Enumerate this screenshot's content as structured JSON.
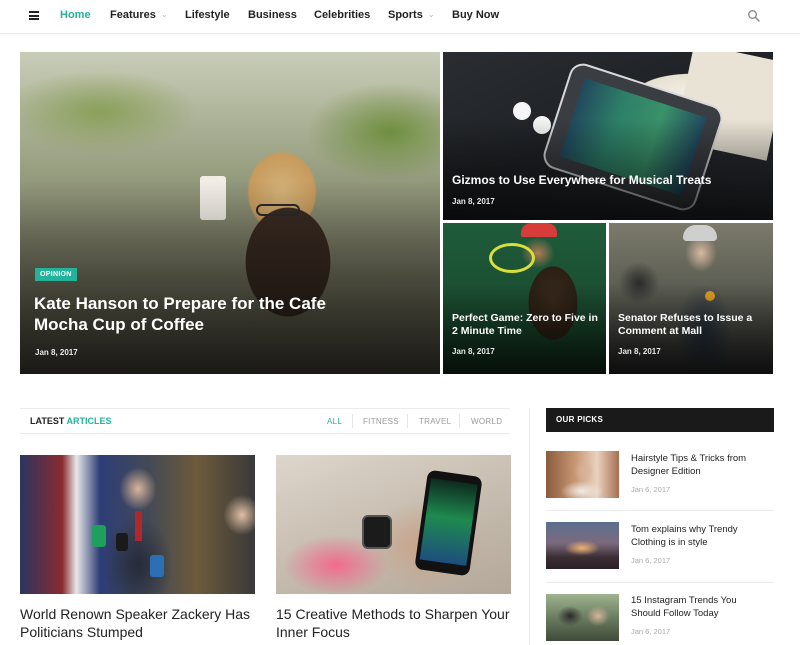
{
  "nav": {
    "items": [
      {
        "label": "Home",
        "active": true,
        "has_dropdown": false
      },
      {
        "label": "Features",
        "active": false,
        "has_dropdown": true
      },
      {
        "label": "Lifestyle",
        "active": false,
        "has_dropdown": false
      },
      {
        "label": "Business",
        "active": false,
        "has_dropdown": false
      },
      {
        "label": "Celebrities",
        "active": false,
        "has_dropdown": false
      },
      {
        "label": "Sports",
        "active": false,
        "has_dropdown": true
      },
      {
        "label": "Buy Now",
        "active": false,
        "has_dropdown": false
      }
    ],
    "dropdown_glyph": "⌄",
    "menu_icon": "hamburger-menu-icon",
    "search_icon": "search-icon"
  },
  "hero": {
    "main": {
      "badge": "OPINION",
      "title": "Kate Hanson to Prepare for the Cafe Mocha Cup of Coffee",
      "date": "Jan 8, 2017"
    },
    "top_right": {
      "title": "Gizmos to Use Everywhere for Musical Treats",
      "date": "Jan 8, 2017"
    },
    "bottom_left": {
      "title": "Perfect Game: Zero to Five in 2 Minute Time",
      "date": "Jan 8, 2017"
    },
    "bottom_right": {
      "title": "Senator Refuses to Issue a Comment at Mall",
      "date": "Jan 8, 2017"
    }
  },
  "latest": {
    "title_part1": "LATEST",
    "title_part2": "ARTICLES",
    "filters": [
      "ALL",
      "FITNESS",
      "TRAVEL",
      "WORLD"
    ],
    "active_filter": "ALL",
    "articles": [
      {
        "title": "World Renown Speaker Zackery Has Politicians Stumped"
      },
      {
        "title": "15 Creative Methods to Sharpen Your Inner Focus"
      }
    ]
  },
  "picks": {
    "heading": "OUR PICKS",
    "items": [
      {
        "title": "Hairstyle Tips & Tricks from Designer Edition",
        "date": "Jan 6, 2017"
      },
      {
        "title": "Tom explains why Trendy Clothing is in style",
        "date": "Jan 6, 2017"
      },
      {
        "title": "15 Instagram Trends You Should Follow Today",
        "date": "Jan 6, 2017"
      }
    ]
  },
  "colors": {
    "accent": "#23b29a",
    "dark": "#1a1a1a",
    "text": "#222222",
    "muted": "#a9a9a9"
  }
}
